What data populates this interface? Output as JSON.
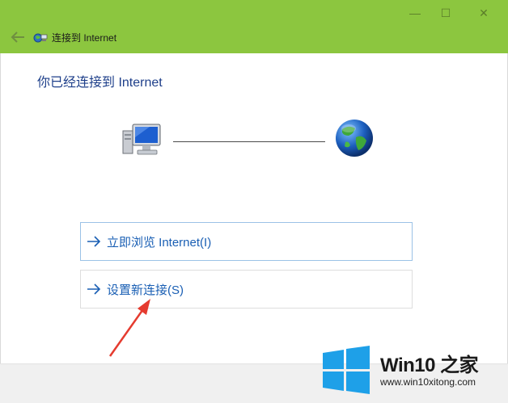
{
  "window": {
    "title": "连接到 Internet",
    "controls": {
      "minimize": "—",
      "maximize": "☐",
      "close": "✕"
    },
    "accent_color": "#8cc63f"
  },
  "main": {
    "heading": "你已经连接到 Internet",
    "options": [
      {
        "label": "立即浏览 Internet(I)"
      },
      {
        "label": "设置新连接(S)"
      }
    ]
  },
  "watermark": {
    "brand": "Win10 之家",
    "url": "www.win10xitong.com"
  }
}
